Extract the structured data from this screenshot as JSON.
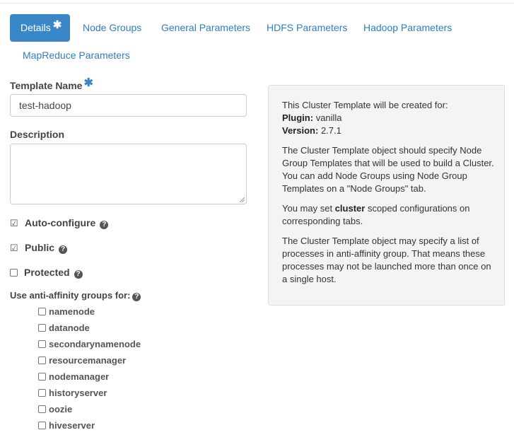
{
  "tabs": {
    "details": "Details",
    "node_groups": "Node Groups",
    "general": "General Parameters",
    "hdfs": "HDFS Parameters",
    "hadoop": "Hadoop Parameters",
    "mapreduce": "MapReduce Parameters"
  },
  "form": {
    "template_name_label": "Template Name",
    "template_name_value": "test-hadoop",
    "description_label": "Description",
    "auto_configure": "Auto-configure",
    "public": "Public",
    "protected": "Protected",
    "anti_affinity_label": "Use anti-affinity groups for:",
    "anti_affinity_options": [
      "namenode",
      "datanode",
      "secondarynamenode",
      "resourcemanager",
      "nodemanager",
      "historyserver",
      "oozie",
      "hiveserver"
    ]
  },
  "info": {
    "intro": "This Cluster Template will be created for:",
    "plugin_label": "Plugin",
    "plugin_value": "vanilla",
    "version_label": "Version",
    "version_value": "2.7.1",
    "para1": "The Cluster Template object should specify Node Group Templates that will be used to build a Cluster. You can add Node Groups using Node Group Templates on a \"Node Groups\" tab.",
    "para2_pre": "You may set ",
    "para2_bold": "cluster",
    "para2_post": " scoped configurations on corresponding tabs.",
    "para3": "The Cluster Template object may specify a list of processes in anti-affinity group. That means these processes may not be launched more than once on a single host."
  },
  "colors": {
    "accent": "#3a87c8",
    "link": "#2e7fbf"
  }
}
